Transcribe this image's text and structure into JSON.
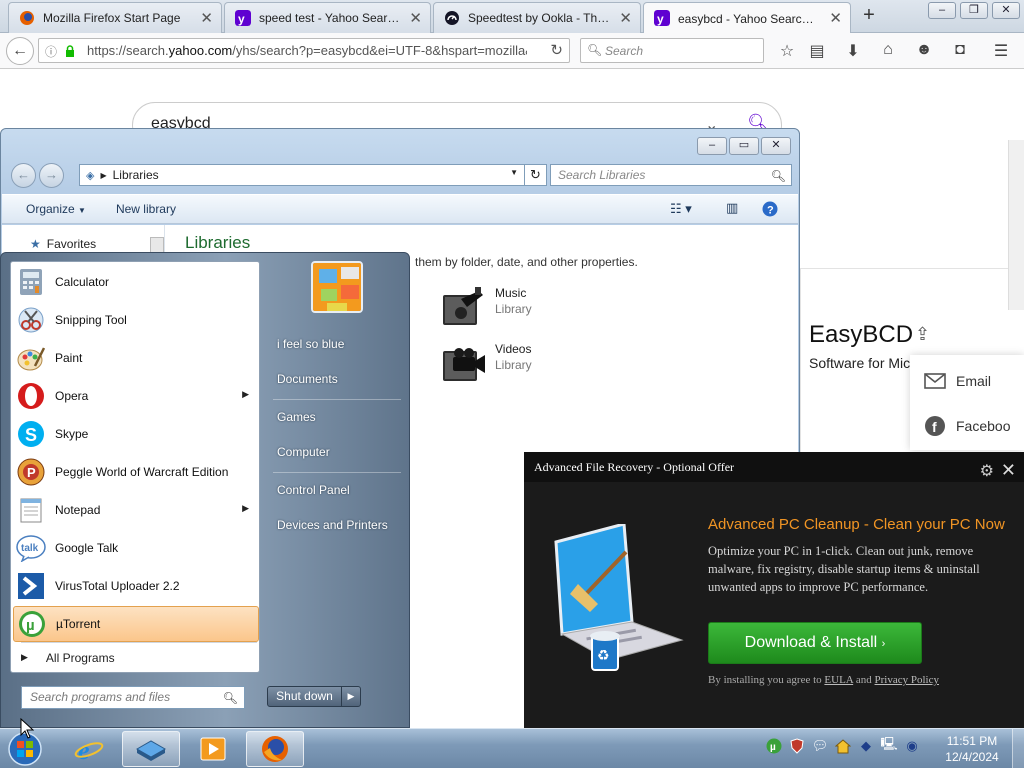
{
  "browser": {
    "tabs": [
      {
        "title": "Mozilla Firefox Start Page",
        "favicon": "firefox-icon",
        "active": false
      },
      {
        "title": "speed test - Yahoo Search ...",
        "favicon": "yahoo-icon",
        "active": false
      },
      {
        "title": "Speedtest by Ookla - The ...",
        "favicon": "speedtest-icon",
        "active": false
      },
      {
        "title": "easybcd - Yahoo Search Re...",
        "favicon": "yahoo-icon",
        "active": true
      }
    ],
    "url_prefix": "https://search.",
    "url_domain": "yahoo.com",
    "url_rest": "/yhs/search?p=easybcd&ei=UTF-8&hspart=mozilla&h",
    "search_placeholder": "Search"
  },
  "page": {
    "query": "easybcd",
    "card_title": "EasyBCD",
    "card_subtitle": "Software for Micr",
    "share_email": "Email",
    "share_facebook": "Faceboo"
  },
  "explorer": {
    "address": "Libraries",
    "search_placeholder": "Search Libraries",
    "toolbar_organize": "Organize",
    "toolbar_new_library": "New library",
    "sidebar_favorites": "Favorites",
    "heading": "Libraries",
    "subheading": "them by folder, date, and other properties.",
    "libraries": [
      {
        "name": "Music",
        "type": "Library"
      },
      {
        "name": "Videos",
        "type": "Library"
      }
    ]
  },
  "startmenu": {
    "programs": [
      {
        "label": "Calculator",
        "icon": "calculator-icon",
        "submenu": false
      },
      {
        "label": "Snipping Tool",
        "icon": "scissors-icon",
        "submenu": false
      },
      {
        "label": "Paint",
        "icon": "paint-icon",
        "submenu": false
      },
      {
        "label": "Opera",
        "icon": "opera-icon",
        "submenu": true
      },
      {
        "label": "Skype",
        "icon": "skype-icon",
        "submenu": false
      },
      {
        "label": "Peggle World of Warcraft Edition",
        "icon": "peggle-icon",
        "submenu": false
      },
      {
        "label": "Notepad",
        "icon": "notepad-icon",
        "submenu": true
      },
      {
        "label": "Google Talk",
        "icon": "talk-icon",
        "submenu": false
      },
      {
        "label": "VirusTotal Uploader 2.2",
        "icon": "virustotal-icon",
        "submenu": false
      },
      {
        "label": "µTorrent",
        "icon": "utorrent-icon",
        "submenu": false
      }
    ],
    "all_programs": "All Programs",
    "search_placeholder": "Search programs and files",
    "right_items": [
      "i feel so blue",
      "Documents",
      "Games",
      "Computer",
      "Control Panel",
      "Devices and Printers"
    ],
    "shutdown": "Shut down"
  },
  "offer": {
    "header": "Advanced File Recovery - Optional Offer",
    "title": "Advanced PC Cleanup - Clean your PC Now",
    "description": "Optimize your PC in 1-click. Clean out junk, remove malware, fix registry, disable startup items & uninstall unwanted apps to improve PC performance.",
    "button": "Download & Install",
    "footer_prefix": "By installing you agree to",
    "footer_eula": "EULA",
    "footer_and": "and",
    "footer_privacy": "Privacy Policy",
    "accent_color": "#f19524",
    "button_color": "#2aa028"
  },
  "taskbar": {
    "time": "11:51 PM",
    "date": "12/4/2024"
  }
}
